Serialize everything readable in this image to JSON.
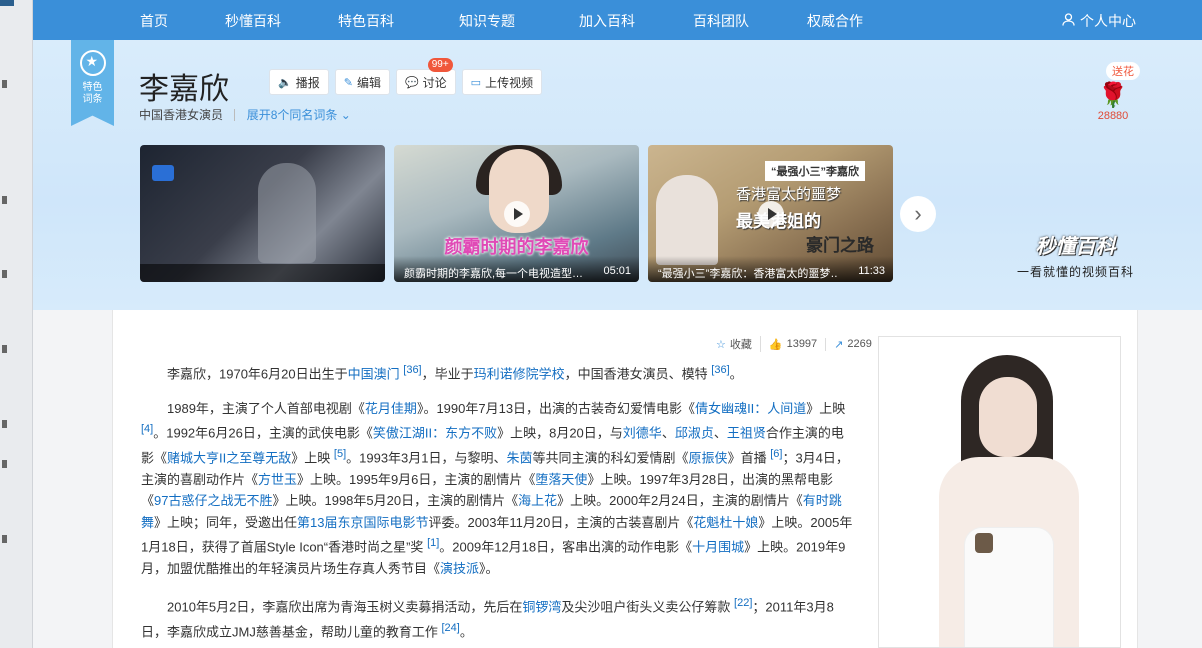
{
  "nav": {
    "items": [
      "首页",
      "秒懂百科",
      "特色百科",
      "知识专题",
      "加入百科",
      "百科团队",
      "权威合作"
    ],
    "user": "个人中心"
  },
  "badge": {
    "line1": "特色",
    "line2": "词条"
  },
  "entry": {
    "title": "李嘉欣",
    "subtitle": "中国香港女演员",
    "expand": "展开8个同名词条"
  },
  "actions": {
    "broadcast": "播报",
    "edit": "编辑",
    "discuss": "讨论",
    "discuss_count": "99+",
    "upload": "上传视频"
  },
  "flower": {
    "send": "送花",
    "count": "28880"
  },
  "videos": [
    {
      "caption": "",
      "duration": ""
    },
    {
      "overlay": "颜霸时期的李嘉欣",
      "caption": "颜霸时期的李嘉欣,每一个电视造型…",
      "duration": "05:01"
    },
    {
      "tag": "“最强小三”李嘉欣",
      "line1": "香港富太的噩梦",
      "line2": "最美港姐的",
      "line3": "豪门之路",
      "caption": "“最强小三”李嘉欣：香港富太的噩梦…",
      "duration": "11:33"
    }
  ],
  "brand": {
    "name": "秒懂百科",
    "slogan": "一看就懂的视频百科"
  },
  "meta": {
    "favorite": "收藏",
    "likes": "13997",
    "shares": "2269"
  },
  "article": {
    "p1": {
      "t1": "李嘉欣，1970年6月20日出生于",
      "l1": "中国澳门",
      "s1": "[36]",
      "t2": "，毕业于",
      "l2": "玛利诺修院学校",
      "t3": "，中国香港女演员、模特",
      "s2": "[36]",
      "t4": "。"
    },
    "p2": {
      "t1": "1989年，主演了个人首部电视剧《",
      "l1": "花月佳期",
      "t2": "》。1990年7月13日，出演的古装奇幻爱情电影《",
      "l2": "倩女幽魂II：人间道",
      "t3": "》上映",
      "s1": "[4]",
      "t4": "。1992年6月26日，主演的武侠电影《",
      "l3": "笑傲江湖II：东方不败",
      "t5": "》上映，8月20日，与",
      "l4": "刘德华",
      "t6": "、",
      "l5": "邱淑贞",
      "t7": "、",
      "l6": "王祖贤",
      "t8": "合作主演的电影《",
      "l7": "赌城大亨II之至尊无敌",
      "t9": "》上映",
      "s2": "[5]",
      "t10": "。1993年3月1日，与黎明、",
      "l8": "朱茵",
      "t11": "等共同主演的科幻爱情剧《",
      "l9": "原振侠",
      "t12": "》首播",
      "s3": "[6]",
      "t13": "；3月4日，主演的喜剧动作片《",
      "l10": "方世玉",
      "t14": "》上映。1995年9月6日，主演的剧情片《",
      "l11": "堕落天使",
      "t15": "》上映。1997年3月28日，出演的黑帮电影《",
      "l12": "97古惑仔之战无不胜",
      "t16": "》上映。1998年5月20日，主演的剧情片《",
      "l13": "海上花",
      "t17": "》上映。2000年2月24日，主演的剧情片《",
      "l14": "有时跳舞",
      "t18": "》上映；同年，受邀出任",
      "l15": "第13届东京国际电影节",
      "t19": "评委。2003年11月20日，主演的古装喜剧片《",
      "l16": "花魁杜十娘",
      "t20": "》上映。2005年1月18日，获得了首届Style Icon“香港时尚之星”奖",
      "s4": "[1]",
      "t21": "。2009年12月18日，客串出演的动作电影《",
      "l17": "十月围城",
      "t22": "》上映。2019年9月，加盟优酷推出的年轻演员片场生存真人秀节目《",
      "l18": "演技派",
      "t23": "》。"
    },
    "p3": {
      "t1": "2010年5月2日，李嘉欣出席为青海玉树义卖募捐活动，先后在",
      "l1": "铜锣湾",
      "t2": "及尖沙咀户街头义卖公仔筹款",
      "s1": "[22]",
      "t3": "；2011年3月8日，李嘉欣成立JMJ慈善基金，帮助儿童的教育工作",
      "s2": "[24]",
      "t4": "。"
    }
  },
  "colors": {
    "nav_bg": "#3a8fd9",
    "link": "#136ec2",
    "accent_red": "#f0573b"
  }
}
